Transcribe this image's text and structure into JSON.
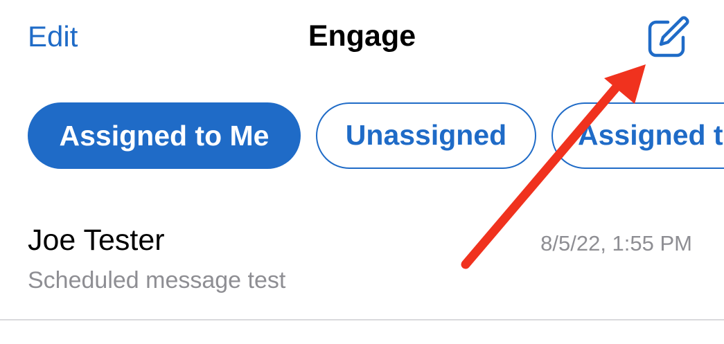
{
  "header": {
    "edit_label": "Edit",
    "title": "Engage",
    "compose_icon": "compose-icon"
  },
  "filters": {
    "chips": [
      {
        "label": "Assigned to Me",
        "selected": true
      },
      {
        "label": "Unassigned",
        "selected": false
      },
      {
        "label": "Assigned t",
        "selected": false
      }
    ]
  },
  "conversations": [
    {
      "name": "Joe Tester",
      "timestamp": "8/5/22, 1:55 PM",
      "preview": "Scheduled message test"
    }
  ],
  "colors": {
    "accent": "#1f6bc7",
    "secondary_text": "#8e8e93",
    "annotation": "#f0321e"
  }
}
